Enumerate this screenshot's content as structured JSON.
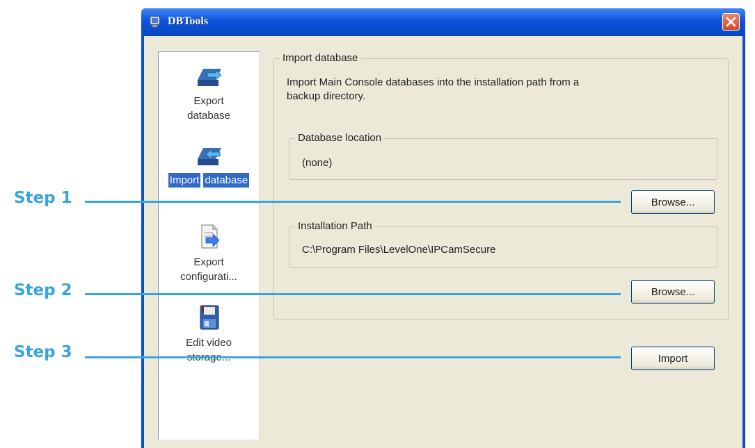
{
  "window": {
    "title": "DBTools"
  },
  "sidebar": {
    "items": [
      {
        "label_lines": [
          "Export",
          "database"
        ],
        "icon": "export-database-icon"
      },
      {
        "label_lines": [
          "Import",
          "database"
        ],
        "icon": "import-database-icon",
        "selected": true
      },
      {
        "label_lines": [
          "Export",
          "configurati..."
        ],
        "icon": "export-configuration-icon"
      },
      {
        "label_lines": [
          "Edit video",
          "storage..."
        ],
        "icon": "edit-video-storage-icon"
      }
    ]
  },
  "main": {
    "group_title": "Import database",
    "description_lines": [
      "Import Main Console databases into the installation path from a",
      "backup directory."
    ],
    "database_location": {
      "label": "Database location",
      "value": "(none)",
      "button": "Browse..."
    },
    "installation_path": {
      "label": "Installation Path",
      "value": "C:\\Program Files\\LevelOne\\IPCamSecure",
      "button": "Browse..."
    },
    "import_button": "Import"
  },
  "annotations": [
    "Step 1",
    "Step 2",
    "Step 3"
  ],
  "colors": {
    "titlebar": "#0c55dc",
    "selection": "#316ac5",
    "annotation": "#3aa5dc",
    "dialog_bg": "#ece9d8"
  }
}
